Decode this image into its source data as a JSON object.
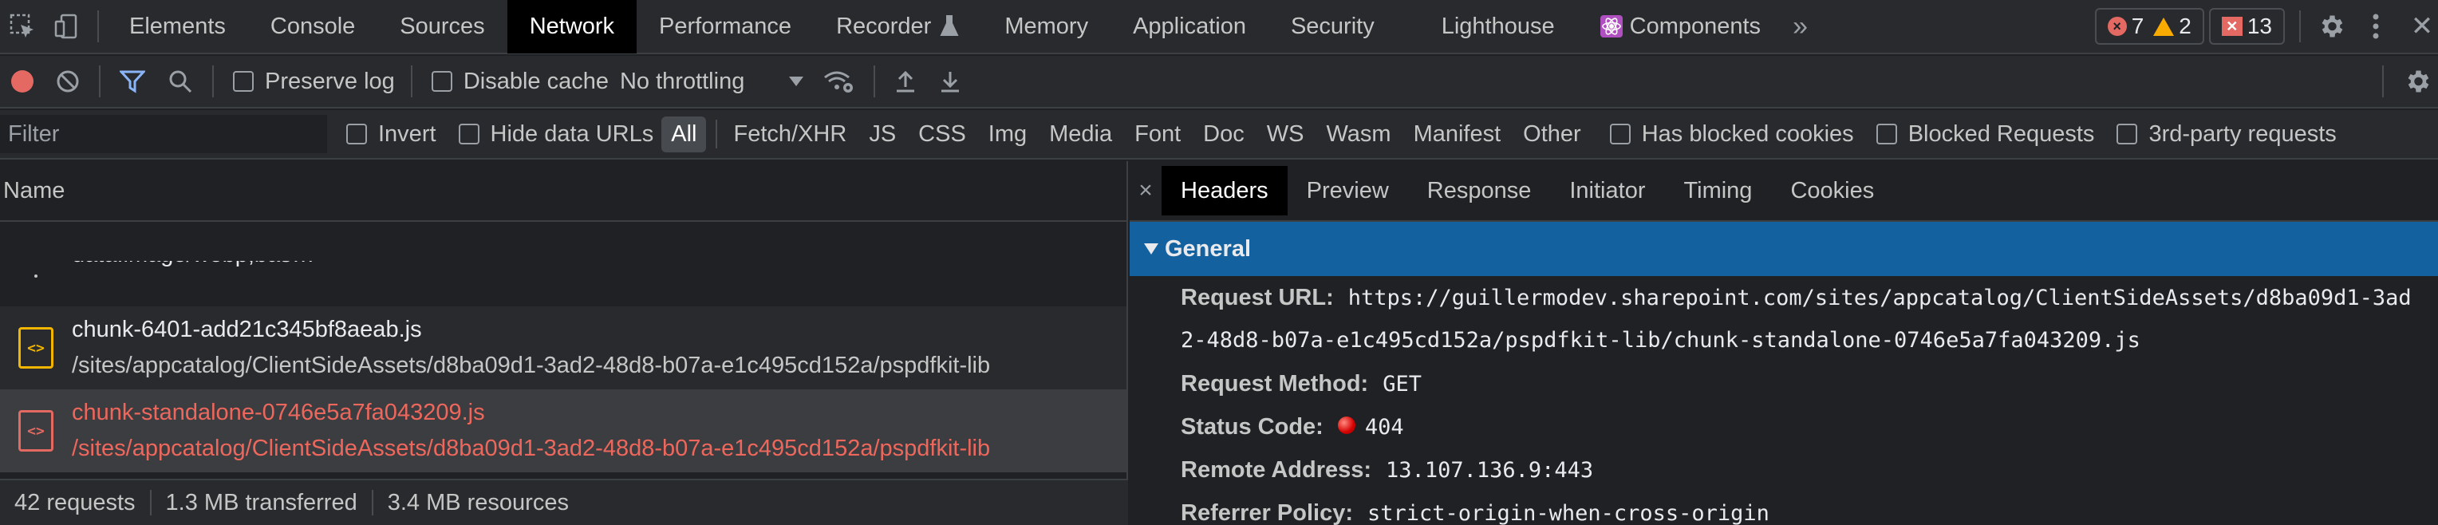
{
  "tabs": {
    "items": [
      "Elements",
      "Console",
      "Sources",
      "Network",
      "Performance",
      "Recorder",
      "Memory",
      "Application",
      "Security",
      "Lighthouse",
      "Components"
    ],
    "active": "Network",
    "more_icon": "double-chevron-icon"
  },
  "badges": {
    "errors": "7",
    "warnings": "2",
    "issues": "13"
  },
  "toolbar": {
    "preserve_log": "Preserve log",
    "disable_cache": "Disable cache",
    "throttling": "No throttling"
  },
  "filter": {
    "placeholder": "Filter",
    "invert": "Invert",
    "hide_data_urls": "Hide data URLs",
    "types": [
      "All",
      "Fetch/XHR",
      "JS",
      "CSS",
      "Img",
      "Media",
      "Font",
      "Doc",
      "WS",
      "Wasm",
      "Manifest",
      "Other"
    ],
    "has_blocked_cookies": "Has blocked cookies",
    "blocked_requests": "Blocked Requests",
    "third_party": "3rd-party requests"
  },
  "requests": {
    "column": "Name",
    "rows": [
      {
        "name": "data:image/webp;bas…",
        "path": ""
      },
      {
        "name": "chunk-6401-add21c345bf8aeab.js",
        "path": "/sites/appcatalog/ClientSideAssets/d8ba09d1-3ad2-48d8-b07a-e1c495cd152a/pspdfkit-lib"
      },
      {
        "name": "chunk-standalone-0746e5a7fa043209.js",
        "path": "/sites/appcatalog/ClientSideAssets/d8ba09d1-3ad2-48d8-b07a-e1c495cd152a/pspdfkit-lib"
      }
    ]
  },
  "status": {
    "requests": "42 requests",
    "transferred": "1.3 MB transferred",
    "resources": "3.4 MB resources"
  },
  "details": {
    "tabs": [
      "Headers",
      "Preview",
      "Response",
      "Initiator",
      "Timing",
      "Cookies"
    ],
    "active_tab": "Headers",
    "section": "General",
    "request_url_label": "Request URL:",
    "request_url_line1": "https://guillermodev.sharepoint.com/sites/appcatalog/ClientSideAssets/d8ba09d1-3ad",
    "request_url_line2": "2-48d8-b07a-e1c495cd152a/pspdfkit-lib/chunk-standalone-0746e5a7fa043209.js",
    "request_method_label": "Request Method:",
    "request_method": "GET",
    "status_code_label": "Status Code:",
    "status_code": "404",
    "remote_address_label": "Remote Address:",
    "remote_address": "13.107.136.9:443",
    "referrer_policy_label": "Referrer Policy:",
    "referrer_policy": "strict-origin-when-cross-origin"
  },
  "colors": {
    "accent": "#8ab4f8",
    "error": "#ee675c",
    "general_bar": "#14619f",
    "record": "#e46962"
  }
}
